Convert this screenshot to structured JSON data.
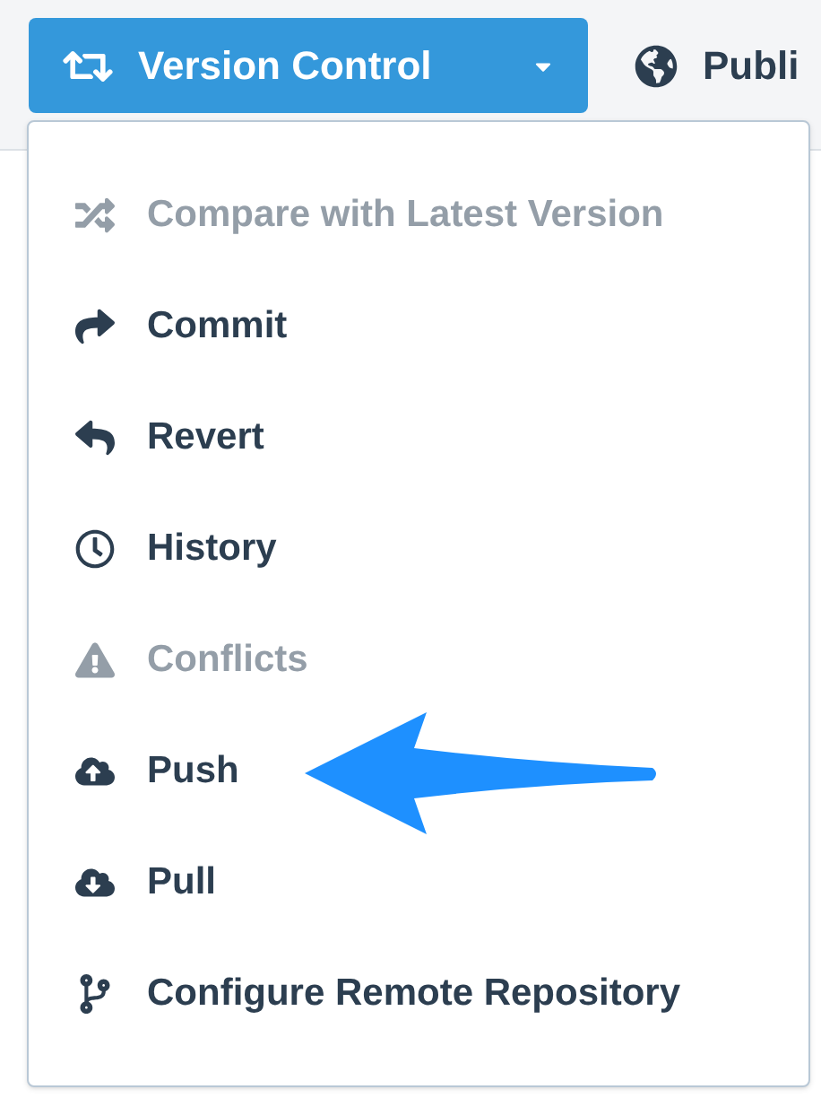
{
  "toolbar": {
    "version_button": {
      "label": "Version Control",
      "expanded": true
    },
    "publish_button": {
      "label": "Publi"
    }
  },
  "menu": {
    "items": [
      {
        "label": "Compare with Latest Version",
        "disabled": true
      },
      {
        "label": "Commit",
        "disabled": false
      },
      {
        "label": "Revert",
        "disabled": false
      },
      {
        "label": "History",
        "disabled": false
      },
      {
        "label": "Conflicts",
        "disabled": true
      },
      {
        "label": "Push",
        "disabled": false
      },
      {
        "label": "Pull",
        "disabled": false
      },
      {
        "label": "Configure Remote Repository",
        "disabled": false
      }
    ]
  }
}
